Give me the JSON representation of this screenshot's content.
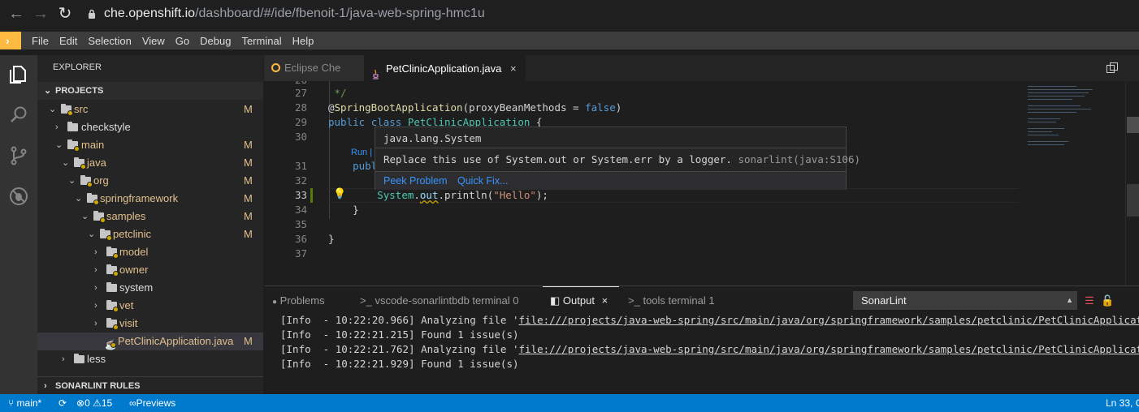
{
  "browser": {
    "url_host": "che.openshift.io",
    "url_path": "/dashboard/#/ide/fbenoit-1/java-web-spring-hmc1u"
  },
  "menu": [
    "File",
    "Edit",
    "Selection",
    "View",
    "Go",
    "Debug",
    "Terminal",
    "Help"
  ],
  "sidebar": {
    "title": "EXPLORER",
    "section": "PROJECTS",
    "tree": [
      {
        "label": "src",
        "modified": "M"
      },
      {
        "label": "checkstyle",
        "modified": ""
      },
      {
        "label": "main",
        "modified": "M"
      },
      {
        "label": "java",
        "modified": "M"
      },
      {
        "label": "org",
        "modified": "M"
      },
      {
        "label": "springframework",
        "modified": "M"
      },
      {
        "label": "samples",
        "modified": "M"
      },
      {
        "label": "petclinic",
        "modified": "M"
      },
      {
        "label": "model",
        "modified": ""
      },
      {
        "label": "owner",
        "modified": ""
      },
      {
        "label": "system",
        "modified": ""
      },
      {
        "label": "vet",
        "modified": ""
      },
      {
        "label": "visit",
        "modified": ""
      },
      {
        "label": "PetClinicApplication.java",
        "modified": "M"
      },
      {
        "label": "less",
        "modified": ""
      }
    ],
    "bottom_section": "SONARLINT RULES"
  },
  "tabs": [
    {
      "label": "Eclipse Che"
    },
    {
      "label": "PetClinicApplication.java",
      "close": "×"
    }
  ],
  "editor": {
    "lines": [
      {
        "n": "26",
        "text": " *"
      },
      {
        "n": "27",
        "text": " */"
      },
      {
        "n": "28",
        "text": "@SpringBootApplication(proxyBeanMethods = false)"
      },
      {
        "n": "29",
        "text": "public class PetClinicApplication {"
      },
      {
        "n": "30",
        "text": ""
      },
      {
        "n": "31",
        "text": "    public"
      },
      {
        "n": "32",
        "text": ""
      },
      {
        "n": "33",
        "text": "        System.out.println(\"Hello\");"
      },
      {
        "n": "34",
        "text": "    }"
      },
      {
        "n": "35",
        "text": ""
      },
      {
        "n": "36",
        "text": "}"
      },
      {
        "n": "37",
        "text": ""
      }
    ],
    "codelens": "Run |",
    "hover": {
      "signature": "java.lang.System",
      "message": "Replace this use of System.out or System.err by a logger.",
      "source": "sonarlint(java:S106)",
      "action_peek": "Peek Problem",
      "action_fix": "Quick Fix..."
    }
  },
  "panel": {
    "tabs": [
      {
        "label": "Problems"
      },
      {
        "label": "vscode-sonarlintbdb terminal 0"
      },
      {
        "label": "Output"
      },
      {
        "label": "tools terminal 1"
      }
    ],
    "output_close": "×",
    "channel": "SonarLint",
    "log": [
      {
        "prefix": "[Info  - 10:22:20.966] Analyzing file '",
        "link": "file:///projects/java-web-spring/src/main/java/org/springframework/samples/petclinic/PetClinicApplication"
      },
      {
        "prefix": "[Info  - 10:22:21.215] Found 1 issue(s)",
        "link": ""
      },
      {
        "prefix": "[Info  - 10:22:21.762] Analyzing file '",
        "link": "file:///projects/java-web-spring/src/main/java/org/springframework/samples/petclinic/PetClinicApplication"
      },
      {
        "prefix": "[Info  - 10:22:21.929] Found 1 issue(s)",
        "link": ""
      }
    ]
  },
  "status": {
    "branch": "main*",
    "errors": "0",
    "warnings": "15",
    "previews": "Previews",
    "position": "Ln 33, C"
  },
  "colors": {
    "accent": "#007acc",
    "che": "#fdb940",
    "modified": "#e2c08d"
  }
}
